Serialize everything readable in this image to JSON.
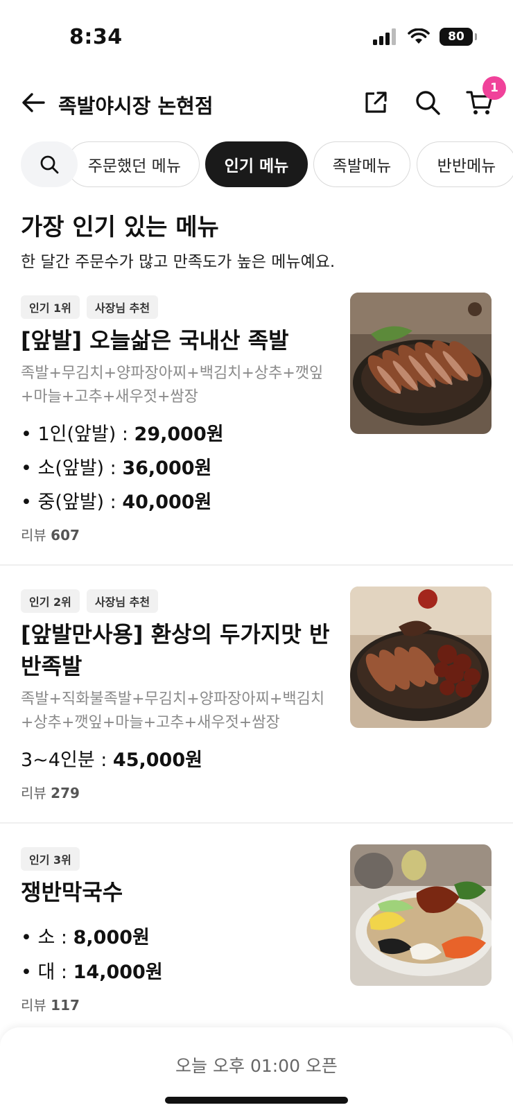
{
  "status": {
    "time": "8:34",
    "battery": "80"
  },
  "header": {
    "title": "족발야시장 논현점",
    "cart_count": "1"
  },
  "tabs": [
    {
      "label": "주문했던 메뉴"
    },
    {
      "label": "인기 메뉴",
      "active": true
    },
    {
      "label": "족발메뉴"
    },
    {
      "label": "반반메뉴"
    }
  ],
  "section": {
    "title": "가장 인기 있는 메뉴",
    "subtitle": "한 달간 주문수가 많고 만족도가 높은 메뉴예요."
  },
  "items": [
    {
      "badges": [
        "인기 1위",
        "사장님 추천"
      ],
      "name": "[앞발] 오늘삶은 국내산 족발",
      "description": "족발+무김치+양파장아찌+백김치+상추+깻잎+마늘+고추+새우젓+쌈장",
      "prices": [
        {
          "label": "• 1인(앞발) : ",
          "price": "29,000원"
        },
        {
          "label": "• 소(앞발) : ",
          "price": "36,000원"
        },
        {
          "label": "• 중(앞발) : ",
          "price": "40,000원"
        }
      ],
      "review_label": "리뷰",
      "review_count": "607"
    },
    {
      "badges": [
        "인기 2위",
        "사장님 추천"
      ],
      "name": "[앞발만사용] 환상의 두가지맛 반반족발",
      "description": "족발+직화불족발+무김치+양파장아찌+백김치+상추+깻잎+마늘+고추+새우젓+쌈장",
      "prices": [
        {
          "label": "3~4인분 : ",
          "price": "45,000원"
        }
      ],
      "review_label": "리뷰",
      "review_count": "279"
    },
    {
      "badges": [
        "인기 3위"
      ],
      "name": "쟁반막국수",
      "description": "",
      "prices": [
        {
          "label": "• 소 : ",
          "price": "8,000원"
        },
        {
          "label": "• 대 : ",
          "price": "14,000원"
        }
      ],
      "review_label": "리뷰",
      "review_count": "117"
    }
  ],
  "bottom": {
    "open_text": "오늘 오후 01:00 오픈"
  },
  "colors": {
    "accent_badge": "#f0429a",
    "active_tab": "#1a1a1a"
  }
}
